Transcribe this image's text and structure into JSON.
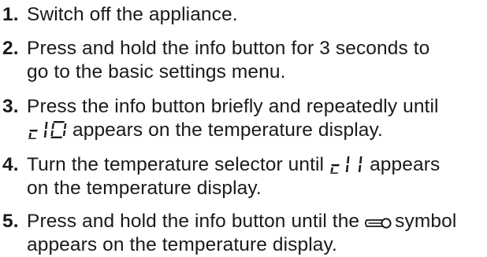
{
  "steps": [
    {
      "number": "1.",
      "line1": "Switch off the appliance."
    },
    {
      "number": "2.",
      "line1": "Press and hold the info button for 3 seconds to",
      "line2": "go to the basic settings menu."
    },
    {
      "number": "3.",
      "line1": "Press the info button briefly and repeatedly until",
      "code": "c 10",
      "line2_after": "appears on the temperature display."
    },
    {
      "number": "4.",
      "line1_before": "Turn the temperature selector until",
      "code": "c 11",
      "line1_after": "appears",
      "line2": "on the temperature display."
    },
    {
      "number": "5.",
      "line1_before": "Press and hold the info button until the",
      "icon": "key-symbol-icon",
      "line1_after": "symbol",
      "line2": "appears on the temperature display."
    }
  ]
}
